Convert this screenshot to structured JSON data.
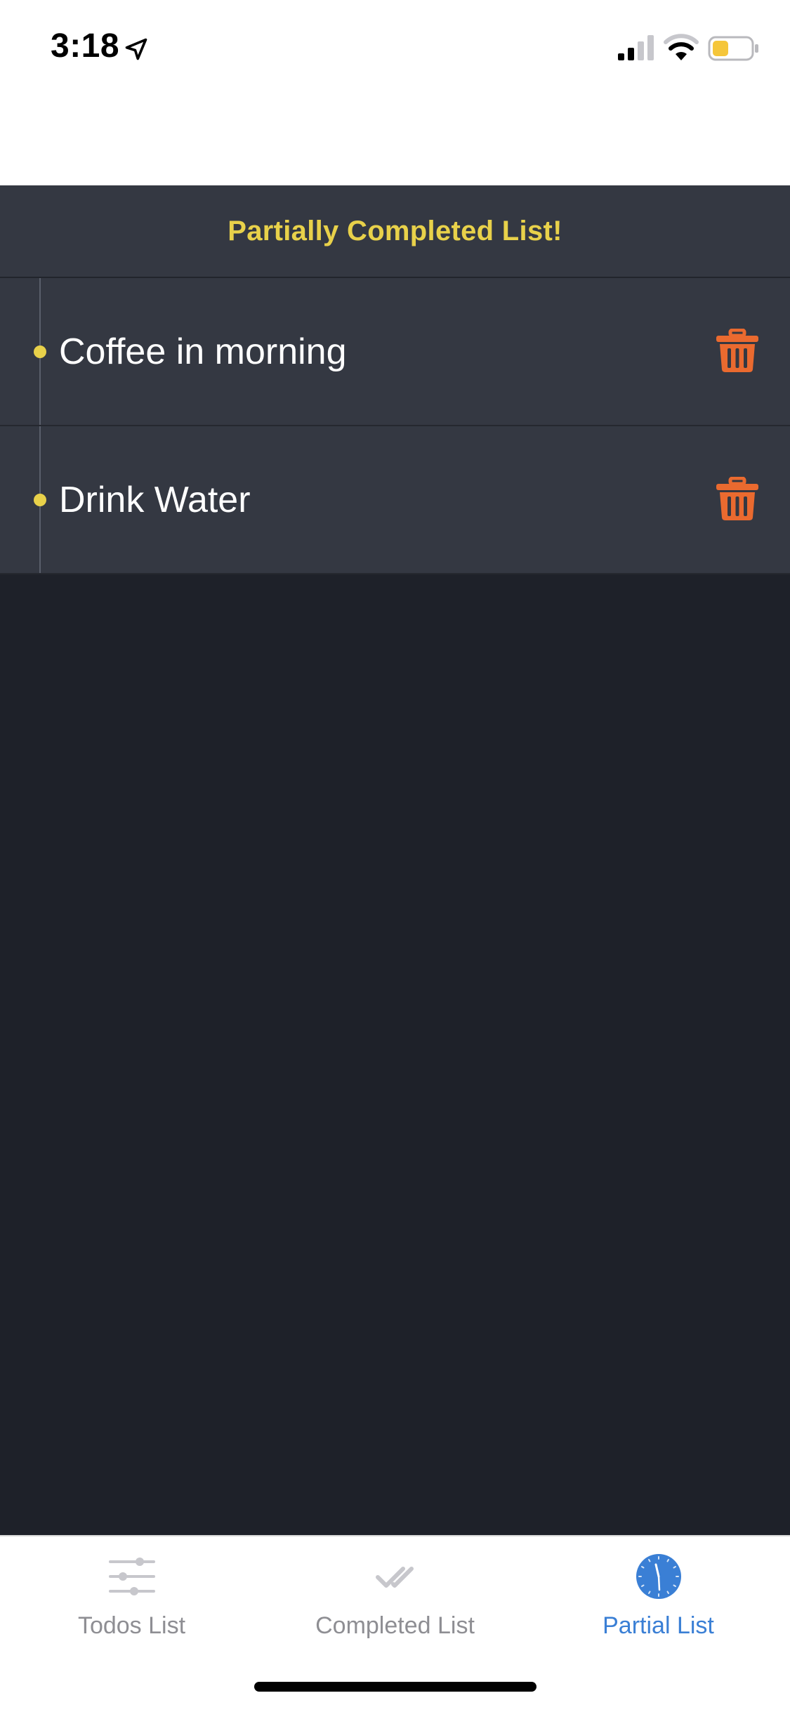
{
  "status_bar": {
    "time": "3:18",
    "icons": [
      "location-arrow-icon",
      "cellular-signal-icon",
      "wifi-icon",
      "battery-icon"
    ],
    "battery_color": "#f5c63a"
  },
  "header": {
    "title": "Partially Completed List!",
    "title_color": "#e8d14a"
  },
  "items": [
    {
      "label": "Coffee in morning",
      "action_icon": "trash-icon"
    },
    {
      "label": "Drink Water",
      "action_icon": "trash-icon"
    }
  ],
  "tab_bar": {
    "tabs": [
      {
        "label": "Todos List",
        "icon": "sliders-icon",
        "active": false
      },
      {
        "label": "Completed List",
        "icon": "double-check-icon",
        "active": false
      },
      {
        "label": "Partial List",
        "icon": "clock-icon",
        "active": true
      }
    ],
    "active_color": "#3a7fd5",
    "inactive_color": "#8e8e93"
  },
  "colors": {
    "accent": "#e8d14a",
    "delete": "#ea6a2f",
    "background": "#1e2129",
    "row_background": "#343842"
  }
}
